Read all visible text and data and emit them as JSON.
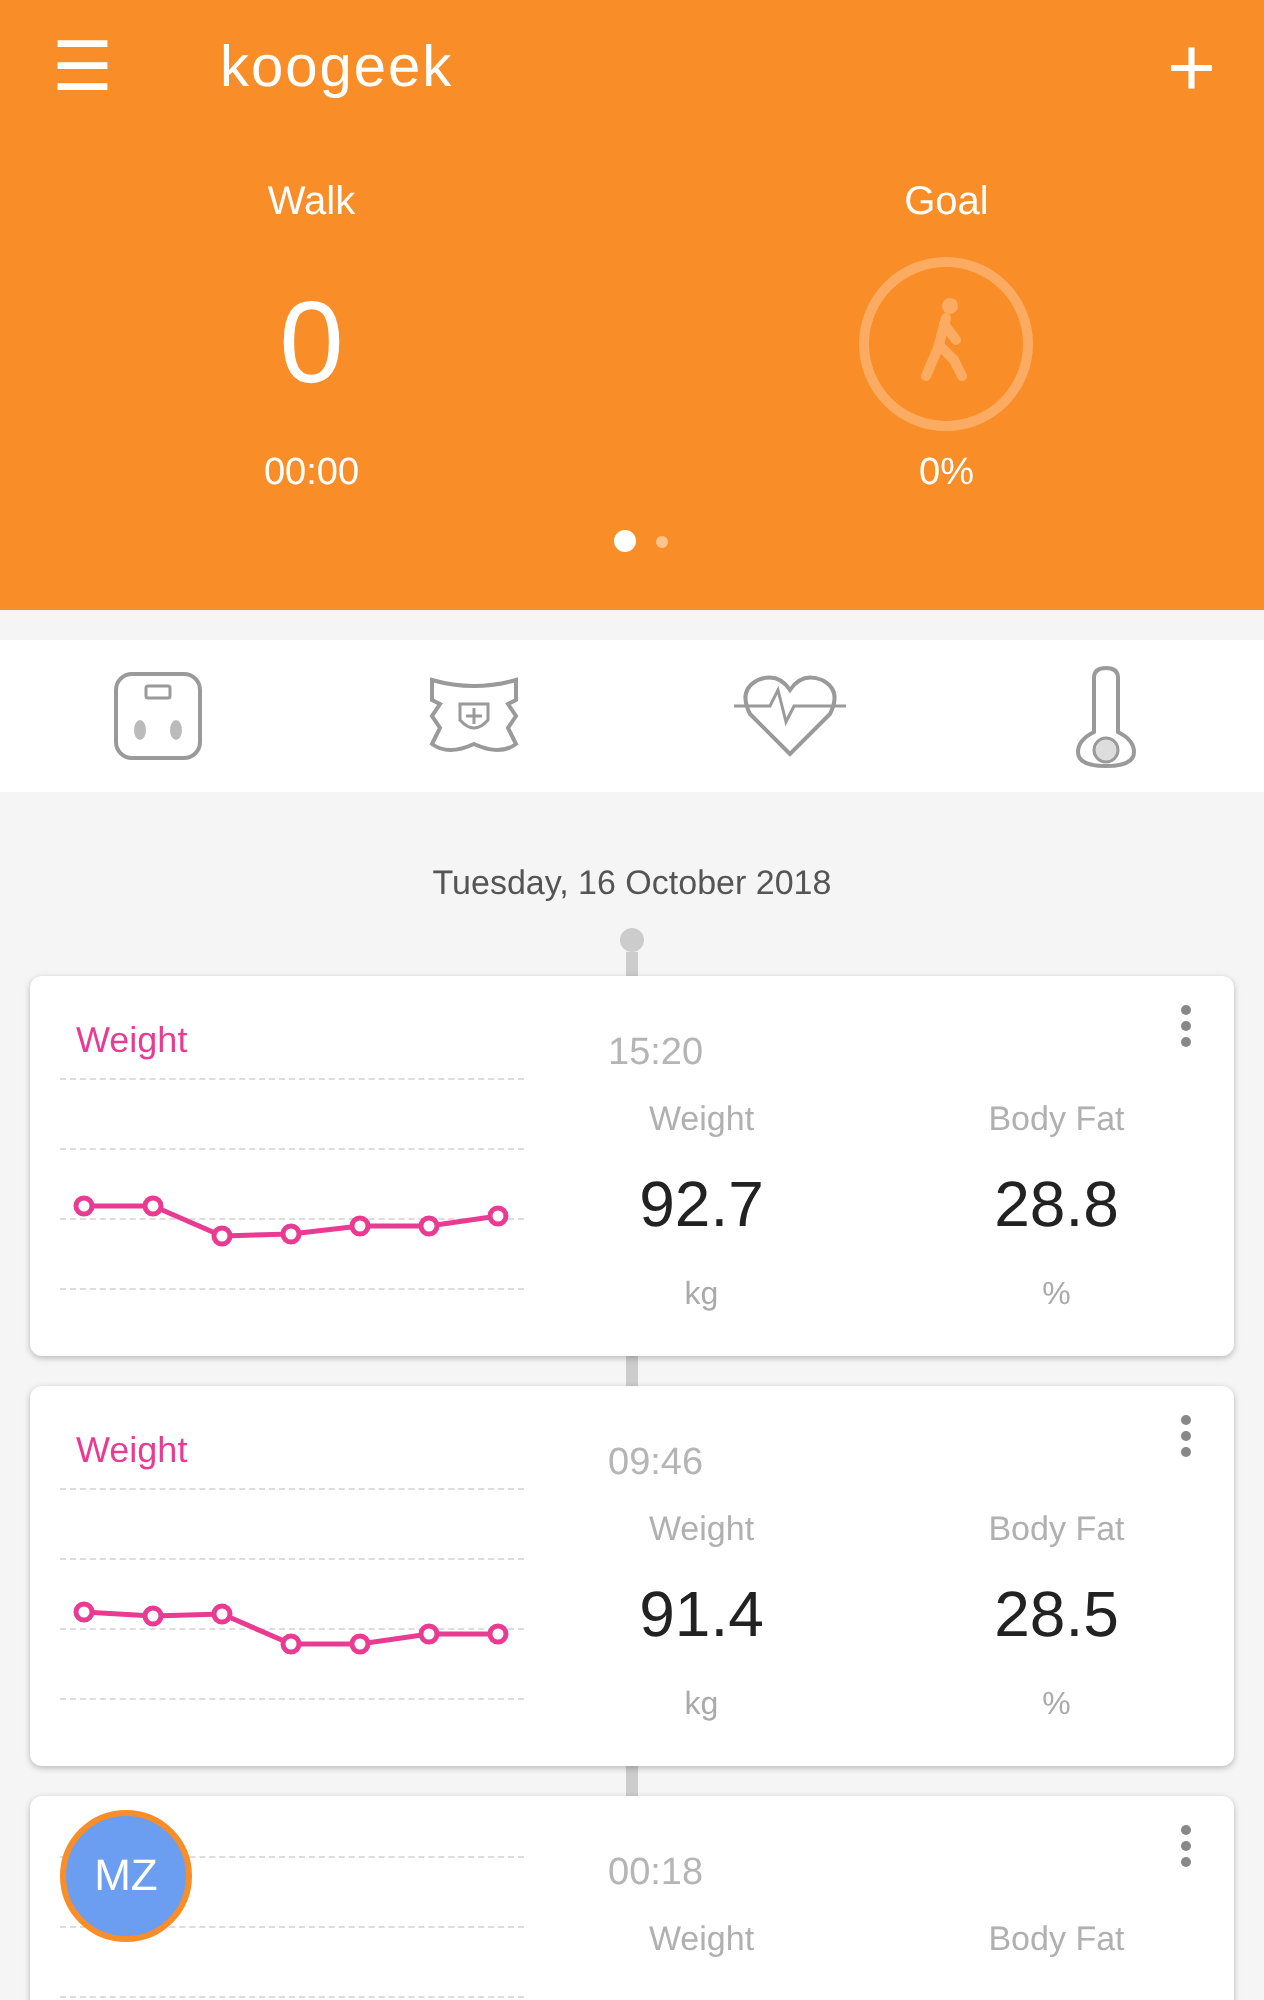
{
  "header": {
    "logo": "koogeek",
    "menu_icon": "☰",
    "add_icon": "+"
  },
  "summary": {
    "walk": {
      "label": "Walk",
      "value": "0",
      "time": "00:00"
    },
    "goal": {
      "label": "Goal",
      "percent": "0%"
    }
  },
  "pages": [
    {
      "selected": true
    },
    {
      "selected": false
    }
  ],
  "categories": [
    {
      "kind": "scale"
    },
    {
      "kind": "body"
    },
    {
      "kind": "heart"
    },
    {
      "kind": "thermometer"
    }
  ],
  "date": "Tuesday, 16 October 2018",
  "records": [
    {
      "title": "Weight",
      "time": "15:20",
      "metrics": [
        {
          "label": "Weight",
          "value": "92.7",
          "unit": "kg"
        },
        {
          "label": "Body Fat",
          "value": "28.8",
          "unit": "%"
        }
      ]
    },
    {
      "title": "Weight",
      "time": "09:46",
      "metrics": [
        {
          "label": "Weight",
          "value": "91.4",
          "unit": "kg"
        },
        {
          "label": "Body Fat",
          "value": "28.5",
          "unit": "%"
        }
      ]
    },
    {
      "time": "00:18",
      "metrics": [
        {
          "label": "Weight"
        },
        {
          "label": "Body Fat"
        }
      ]
    }
  ],
  "avatar": {
    "initials": "MZ"
  }
}
